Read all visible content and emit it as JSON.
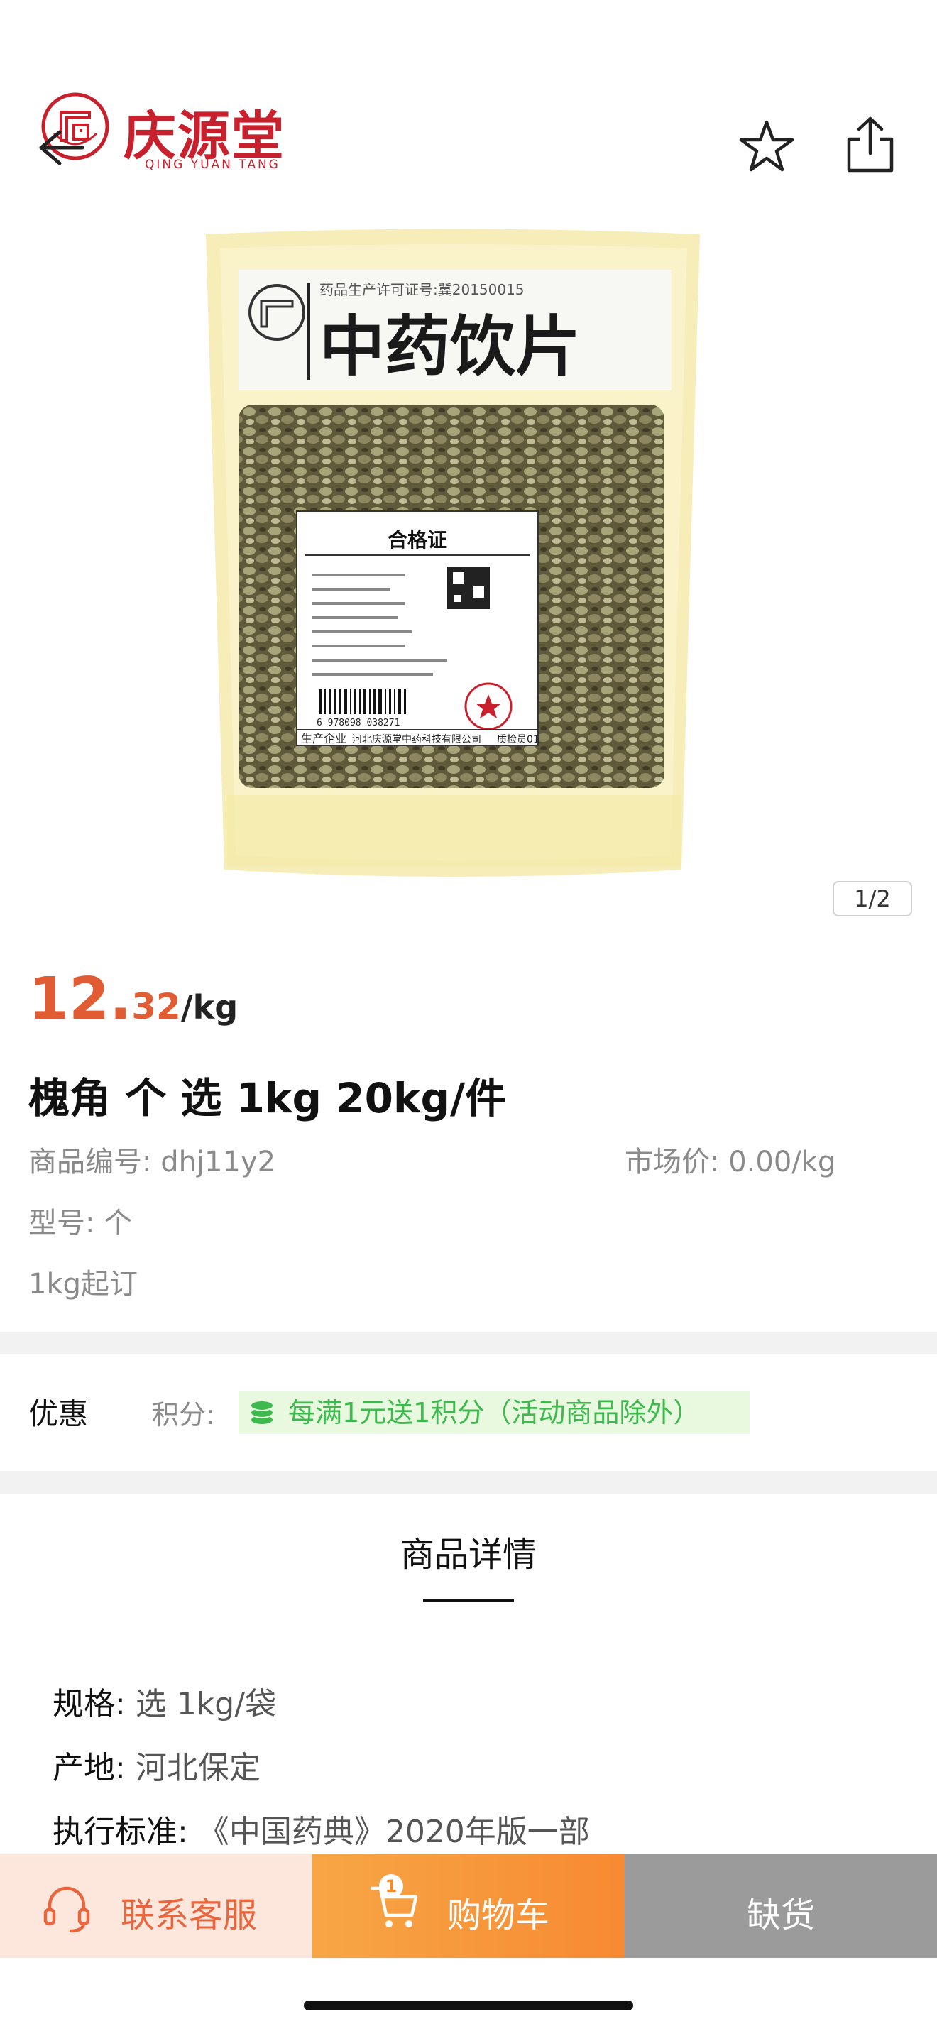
{
  "header": {
    "brand_name": "庆源堂",
    "brand_sub": "QING YUAN TANG"
  },
  "gallery": {
    "page_indicator": "1/2",
    "packaging": {
      "license_text": "药品生产许可证号:冀20150015",
      "heading": "中药饮片",
      "cert_title": "合格证",
      "cert_footer_left": "生产企业",
      "cert_footer_mid": "河北庆源堂中药科技有限公司",
      "cert_footer_right": "质检员01",
      "barcode_number": "6 978098 038271"
    }
  },
  "product": {
    "price_int": "12.",
    "price_dec": "32",
    "price_unit": "/kg",
    "title": "槐角 个 选 1kg 20kg/件",
    "code_label": "商品编号:",
    "code_value": "dhj11y2",
    "market_label": "市场价:",
    "market_value": "0.00/kg",
    "model_label": "型号:",
    "model_value": "个",
    "min_order": "1kg起订"
  },
  "promotion": {
    "label": "优惠",
    "points_label": "积分:",
    "points_text": "每满1元送1积分（活动商品除外）",
    "chip_color": "#3db94d"
  },
  "details": {
    "heading": "商品详情",
    "specs": [
      {
        "label": "规格:",
        "value": "选 1kg/袋"
      },
      {
        "label": "产地:",
        "value": "河北保定"
      },
      {
        "label": "执行标准:",
        "value": "《中国药典》2020年版一部"
      }
    ]
  },
  "bottom_bar": {
    "customer_service": "联系客服",
    "cart": "购物车",
    "cart_badge": "1",
    "out_of_stock": "缺货",
    "accent": "#f78a32"
  }
}
